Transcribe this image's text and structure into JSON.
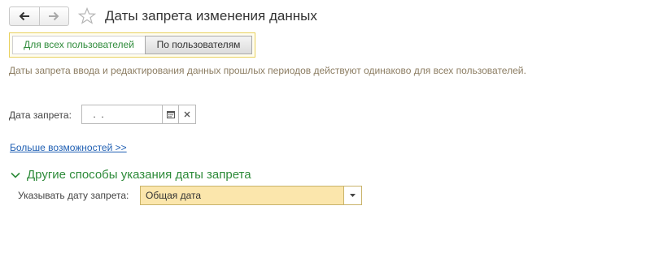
{
  "header": {
    "title": "Даты запрета изменения данных",
    "back_icon": "arrow-left-icon",
    "forward_icon": "arrow-right-icon",
    "favorite_icon": "star-icon"
  },
  "tabs": [
    {
      "label": "Для всех пользователей",
      "active": true
    },
    {
      "label": "По пользователям",
      "active": false
    }
  ],
  "info_text": "Даты запрета ввода и редактирования данных прошлых периодов действуют одинаково для всех пользователей.",
  "date_field": {
    "label": "Дата запрета:",
    "value": " .  ."
  },
  "more_link": "Больше возможностей >>",
  "group": {
    "title": "Другие способы указания даты запрета",
    "expanded": true,
    "mode_label": "Указывать дату запрета:",
    "mode_value": "Общая дата"
  },
  "colors": {
    "accent_green": "#2e8b3a",
    "tab_frame": "#e8d05c",
    "select_bg": "#fbe6ac",
    "link": "#1f5fb3"
  }
}
